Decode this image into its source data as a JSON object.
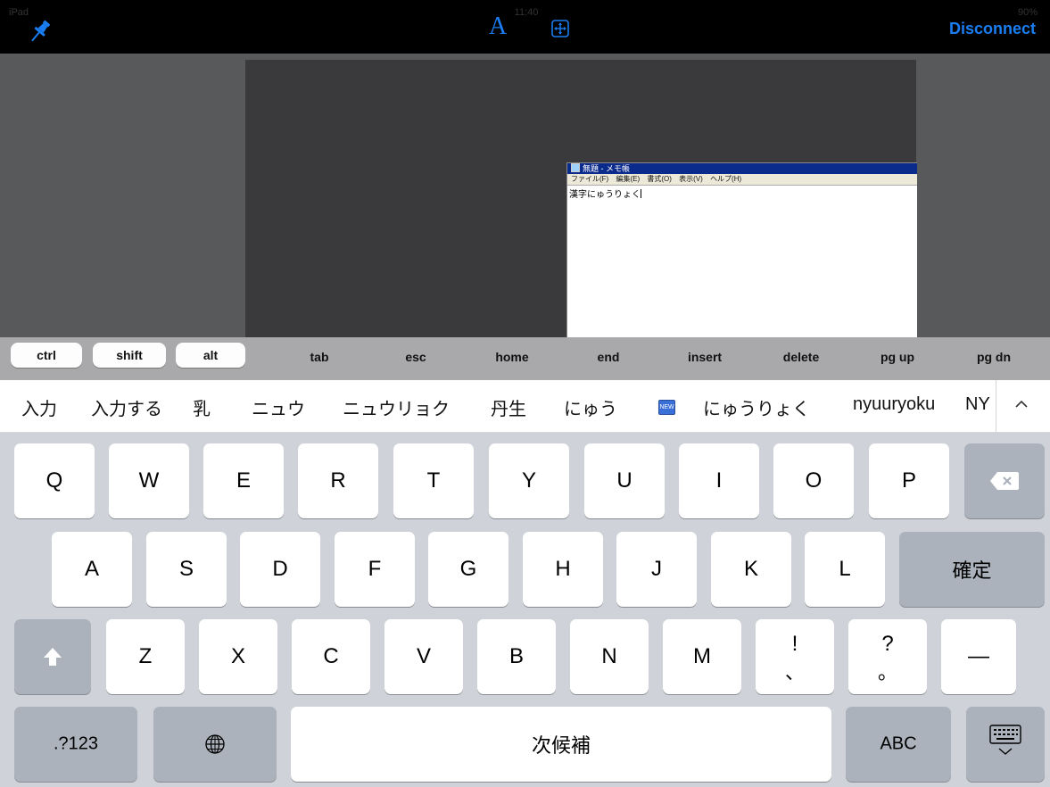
{
  "status_bar": {
    "carrier": "iPad",
    "time": "11:40",
    "battery": "90%"
  },
  "toolbar": {
    "font_label": "A",
    "disconnect_label": "Disconnect"
  },
  "notepad": {
    "title": "無題 - メモ帳",
    "menu": [
      "ファイル(F)",
      "編集(E)",
      "書式(O)",
      "表示(V)",
      "ヘルプ(H)"
    ],
    "text": "漢字にゅうりょく"
  },
  "modifiers": [
    "ctrl",
    "shift",
    "alt"
  ],
  "function_keys": [
    "tab",
    "esc",
    "home",
    "end",
    "insert",
    "delete",
    "pg up",
    "pg dn"
  ],
  "candidates": [
    "入力",
    "入力する",
    "乳",
    "ニュウ",
    "ニュウリョク",
    "丹生",
    "にゅう",
    "にゅうりょく",
    "nyuuryoku",
    "NY"
  ],
  "candidate_badge": "NEW",
  "keyboard": {
    "row1": [
      "Q",
      "W",
      "E",
      "R",
      "T",
      "Y",
      "U",
      "I",
      "O",
      "P"
    ],
    "row2": [
      "A",
      "S",
      "D",
      "F",
      "G",
      "H",
      "J",
      "K",
      "L"
    ],
    "confirm_label": "確定",
    "row3": [
      "Z",
      "X",
      "C",
      "V",
      "B",
      "N",
      "M"
    ],
    "punct1": [
      "!",
      "、"
    ],
    "punct2": [
      "?",
      "。"
    ],
    "dash": "—",
    "numbers_label": ".?123",
    "space_label": "次候補",
    "abc_label": "ABC"
  }
}
